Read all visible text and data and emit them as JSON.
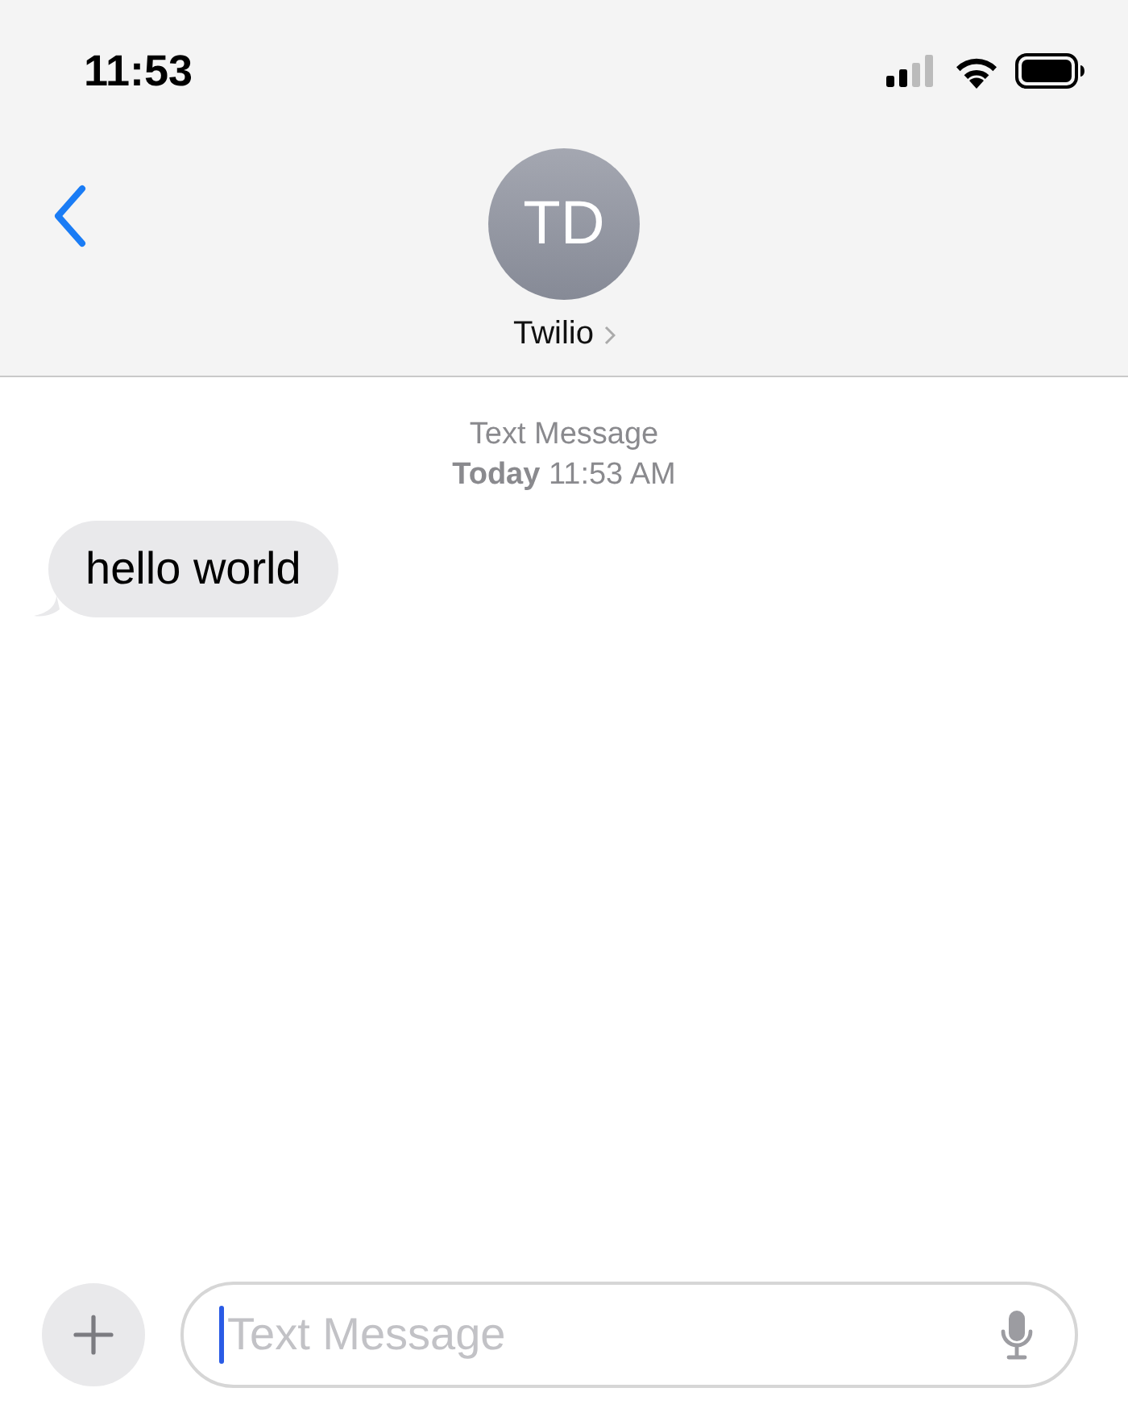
{
  "status_bar": {
    "time": "11:53"
  },
  "header": {
    "avatar_initials": "TD",
    "contact_name": "Twilio"
  },
  "conversation": {
    "service": "Text Message",
    "timestamp": "**Today** 11:53 AM",
    "messages": [
      {
        "kind": "received",
        "text": "hello world"
      }
    ]
  },
  "composer": {
    "placeholder": "Text Message",
    "focused": true
  }
}
